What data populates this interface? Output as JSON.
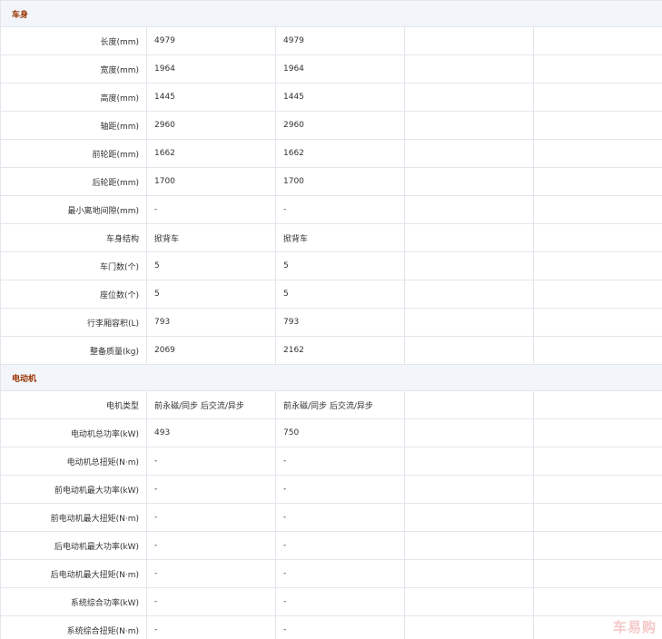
{
  "sections": [
    {
      "title": "车身",
      "rows": [
        {
          "label": "长度(mm)",
          "values": [
            "4979",
            "4979",
            "",
            ""
          ]
        },
        {
          "label": "宽度(mm)",
          "values": [
            "1964",
            "1964",
            "",
            ""
          ]
        },
        {
          "label": "高度(mm)",
          "values": [
            "1445",
            "1445",
            "",
            ""
          ]
        },
        {
          "label": "轴距(mm)",
          "values": [
            "2960",
            "2960",
            "",
            ""
          ]
        },
        {
          "label": "前轮距(mm)",
          "values": [
            "1662",
            "1662",
            "",
            ""
          ]
        },
        {
          "label": "后轮距(mm)",
          "values": [
            "1700",
            "1700",
            "",
            ""
          ]
        },
        {
          "label": "最小离地间隙(mm)",
          "values": [
            "-",
            "-",
            "",
            ""
          ]
        },
        {
          "label": "车身结构",
          "values": [
            "掀背车",
            "掀背车",
            "",
            ""
          ]
        },
        {
          "label": "车门数(个)",
          "values": [
            "5",
            "5",
            "",
            ""
          ]
        },
        {
          "label": "座位数(个)",
          "values": [
            "5",
            "5",
            "",
            ""
          ]
        },
        {
          "label": "行李厢容积(L)",
          "values": [
            "793",
            "793",
            "",
            ""
          ]
        },
        {
          "label": "整备质量(kg)",
          "values": [
            "2069",
            "2162",
            "",
            ""
          ]
        }
      ]
    },
    {
      "title": "电动机",
      "rows": [
        {
          "label": "电机类型",
          "values": [
            "前永磁/同步 后交流/异步",
            "前永磁/同步 后交流/异步",
            "",
            ""
          ]
        },
        {
          "label": "电动机总功率(kW)",
          "values": [
            "493",
            "750",
            "",
            ""
          ]
        },
        {
          "label": "电动机总扭矩(N·m)",
          "values": [
            "-",
            "-",
            "",
            ""
          ]
        },
        {
          "label": "前电动机最大功率(kW)",
          "values": [
            "-",
            "-",
            "",
            ""
          ]
        },
        {
          "label": "前电动机最大扭矩(N·m)",
          "values": [
            "-",
            "-",
            "",
            ""
          ]
        },
        {
          "label": "后电动机最大功率(kW)",
          "values": [
            "-",
            "-",
            "",
            ""
          ]
        },
        {
          "label": "后电动机最大扭矩(N·m)",
          "values": [
            "-",
            "-",
            "",
            ""
          ]
        },
        {
          "label": "系统综合功率(kW)",
          "values": [
            "-",
            "-",
            "",
            ""
          ]
        },
        {
          "label": "系统综合扭矩(N·m)",
          "values": [
            "-",
            "-",
            "",
            ""
          ]
        }
      ]
    }
  ],
  "watermark": "车易购"
}
